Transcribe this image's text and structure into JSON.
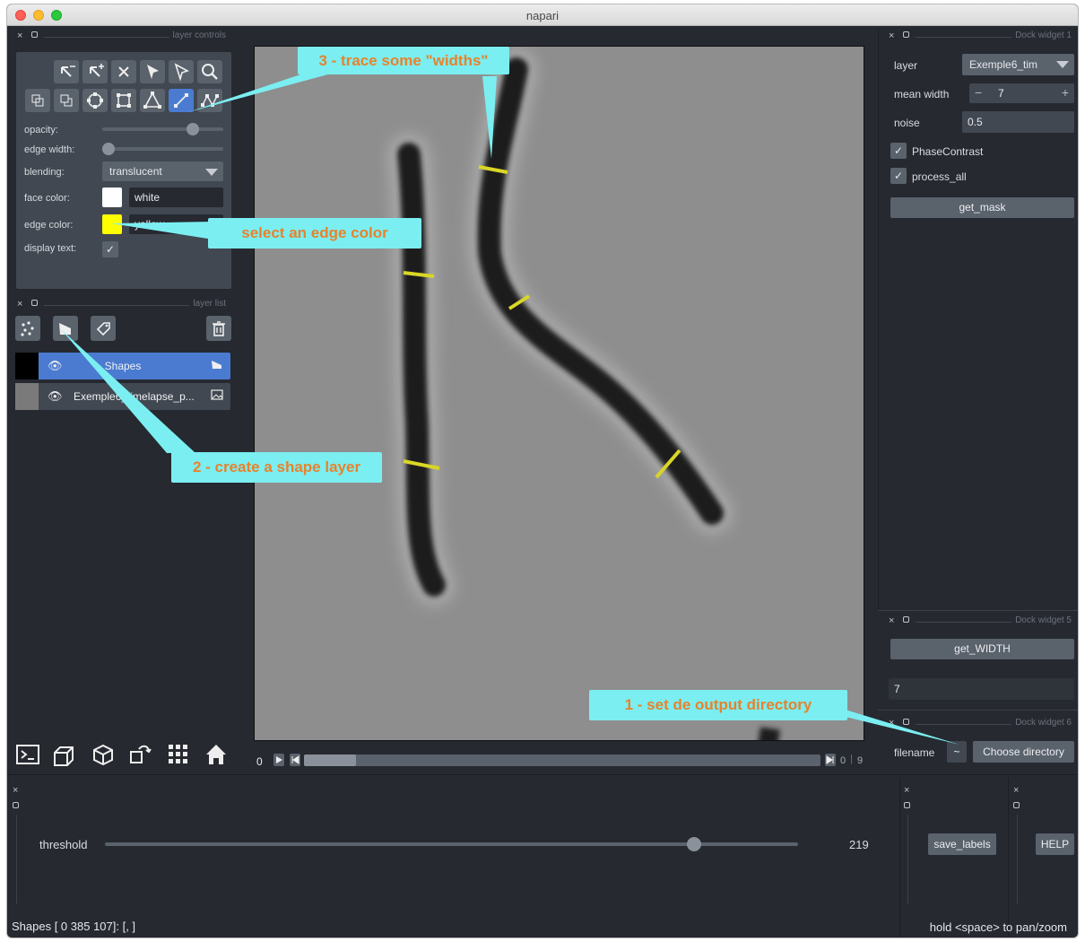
{
  "window": {
    "title": "napari"
  },
  "layer_controls": {
    "dock_title": "layer controls",
    "tools": [
      "remove-vertex-icon",
      "add-vertex-icon",
      "delete-shape-icon",
      "select-icon",
      "direct-select-icon",
      "zoom-icon",
      "move-back-icon",
      "move-front-icon",
      "ellipse-icon",
      "rectangle-icon",
      "polygon-icon",
      "line-icon",
      "path-icon"
    ],
    "opacity_label": "opacity:",
    "opacity_value": 0.75,
    "edge_width_label": "edge width:",
    "edge_width_value": 0.05,
    "blending_label": "blending:",
    "blending_value": "translucent",
    "face_color_label": "face color:",
    "face_color_value": "white",
    "face_color_hex": "#ffffff",
    "edge_color_label": "edge color:",
    "edge_color_value": "yellow",
    "edge_color_hex": "#ffff00",
    "display_text_label": "display text:",
    "check": "✓"
  },
  "layer_list": {
    "dock_title": "layer list",
    "layers": [
      {
        "name": "Shapes",
        "selected": true
      },
      {
        "name": "Exemple6_timelapse_p...",
        "selected": false
      }
    ]
  },
  "viewer": {
    "frame_start": "0",
    "frame_current": "0",
    "frame_total": "9",
    "slider_fraction": 0.0
  },
  "dock1": {
    "title": "Dock widget 1",
    "layer_label": "layer",
    "layer_value": "Exemple6_tim",
    "mean_width_label": "mean width",
    "mean_width_value": "7",
    "minus": "−",
    "plus": "+",
    "noise_label": "noise",
    "noise_value": "0.5",
    "phase_label": "PhaseContrast",
    "process_label": "process_all",
    "get_mask_label": "get_mask"
  },
  "dock5": {
    "title": "Dock widget 5",
    "button_label": "get_WIDTH",
    "value": "7"
  },
  "dock6": {
    "title": "Dock widget 6",
    "filename_label": "filename",
    "filename_value": "~",
    "button_label": "Choose directory"
  },
  "bottom": {
    "threshold_label": "threshold",
    "threshold_value": "219",
    "threshold_fraction": 0.85,
    "save_label": "save_labels",
    "help_label": "HELP"
  },
  "statusbar": {
    "left": "Shapes [  0 385 107]: [, ]",
    "right": "hold <space> to pan/zoom"
  },
  "callouts": {
    "c3": "3 - trace some \"widths\"",
    "edge": "select an edge color",
    "c2": "2 - create a shape layer",
    "c1": "1 - set de output directory"
  },
  "close_glyph": "×"
}
